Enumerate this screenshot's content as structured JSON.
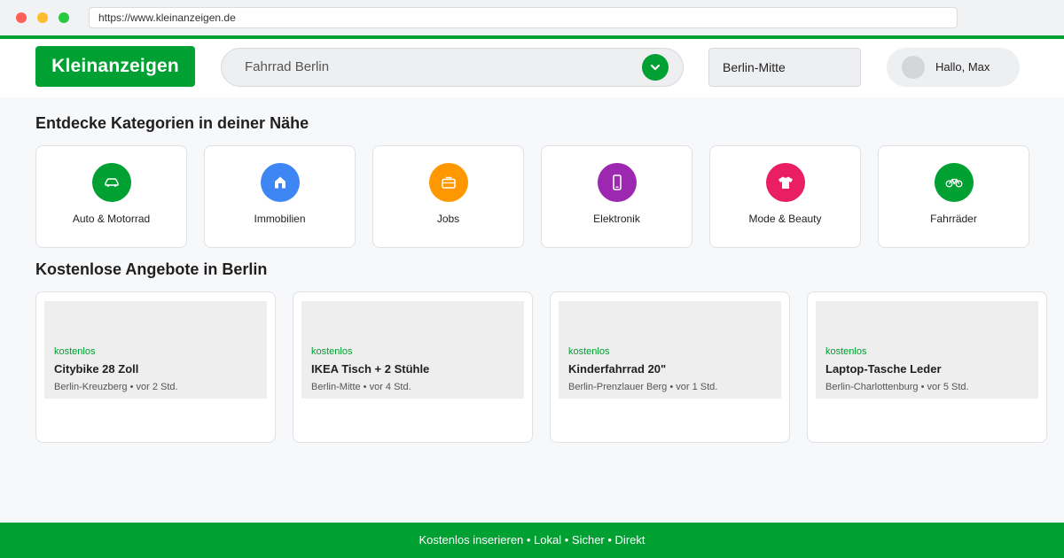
{
  "browser": {
    "url": "https://www.kleinanzeigen.de"
  },
  "header": {
    "logo": "Kleinanzeigen",
    "search_value": "Fahrrad Berlin",
    "location_value": "Berlin-Mitte",
    "user_greeting": "Hallo, Max",
    "icons": {
      "search_button": "chevron-down-icon"
    }
  },
  "categories": {
    "title": "Entdecke Kategorien in deiner Nähe",
    "items": [
      {
        "label": "Auto & Motorrad",
        "color": "#00a032",
        "icon": "car-icon"
      },
      {
        "label": "Immobilien",
        "color": "#3f86f5",
        "icon": "house-icon"
      },
      {
        "label": "Jobs",
        "color": "#ff9800",
        "icon": "briefcase-icon"
      },
      {
        "label": "Elektronik",
        "color": "#9c27b0",
        "icon": "phone-icon"
      },
      {
        "label": "Mode & Beauty",
        "color": "#e91e63",
        "icon": "shirt-icon"
      },
      {
        "label": "Fahrräder",
        "color": "#00a032",
        "icon": "bicycle-icon"
      }
    ]
  },
  "offers": {
    "title": "Kostenlose Angebote in Berlin",
    "items": [
      {
        "badge": "kostenlos",
        "title": "Citybike 28 Zoll",
        "meta": "Berlin-Kreuzberg • vor 2 Std."
      },
      {
        "badge": "kostenlos",
        "title": "IKEA Tisch + 2 Stühle",
        "meta": "Berlin-Mitte • vor 4 Std."
      },
      {
        "badge": "kostenlos",
        "title": "Kinderfahrrad 20\"",
        "meta": "Berlin-Prenzlauer Berg • vor 1 Std."
      },
      {
        "badge": "kostenlos",
        "title": "Laptop-Tasche Leder",
        "meta": "Berlin-Charlottenburg • vor 5 Std."
      }
    ]
  },
  "footer": {
    "text": "Kostenlos inserieren • Lokal • Sicher • Direkt"
  },
  "colors": {
    "brand": "#00a032",
    "background": "#f7f8fa"
  }
}
